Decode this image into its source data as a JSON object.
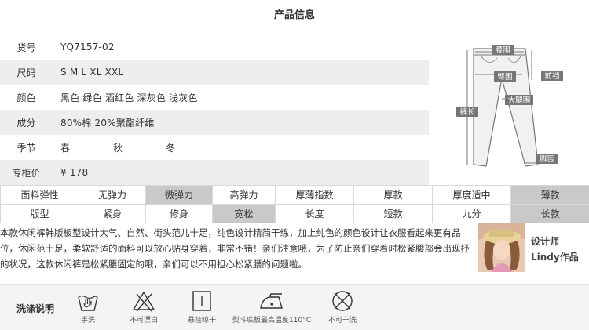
{
  "title": "产品信息",
  "info": [
    {
      "label": "货号",
      "value": "YQ7157-02"
    },
    {
      "label": "尺码",
      "value": "S M L XL XXL"
    },
    {
      "label": "颜色",
      "value": "黑色 绿色 酒红色 深灰色 浅灰色"
    },
    {
      "label": "成分",
      "value": "80%棉 20%聚酯纤维"
    },
    {
      "label": "季节",
      "seasons": [
        "春",
        "秋",
        "冬"
      ]
    },
    {
      "label": "专柜价",
      "value": "¥ 178"
    }
  ],
  "diagram": {
    "waist": "腰围",
    "hip": "臀围",
    "rise": "前裆",
    "thigh": "大腿围",
    "length": "裤长",
    "hem": "脚围"
  },
  "attributes": {
    "elasticity": {
      "label": "面料弹性",
      "options": [
        "无弹力",
        "微弹力",
        "高弹力"
      ],
      "selected": "微弹力"
    },
    "thickness": {
      "label": "厚薄指数",
      "options": [
        "厚款",
        "厚度适中",
        "薄款"
      ],
      "selected": "薄款"
    },
    "fit": {
      "label": "版型",
      "options": [
        "紧身",
        "修身",
        "宽松"
      ],
      "selected": "宽松"
    },
    "length": {
      "label": "长度",
      "options": [
        "短款",
        "九分",
        "长款"
      ],
      "selected": "长款"
    }
  },
  "description": "本款休闲裤韩版板型设计大气、自然、街头范儿十足，纯色设计精简干练，加上纯色的颜色设计让衣服看起来更有品位，休闲范十足，柔软舒适的面料可以放心贴身穿着，非常不错！亲们注意哦，为了防止亲们穿着时松紧腰部会出现抒的状况，这款休闲裤是松紧腰固定的哦，亲们可以不用担心松紧腰的问题啦。",
  "designer": {
    "line1": "设计师",
    "line2": "Lindy作品"
  },
  "wash": {
    "title": "洗涤说明",
    "items": [
      "手洗",
      "不可漂白",
      "悬挂晾干",
      "熨斗底板最高温度110°C",
      "不可干洗"
    ]
  }
}
